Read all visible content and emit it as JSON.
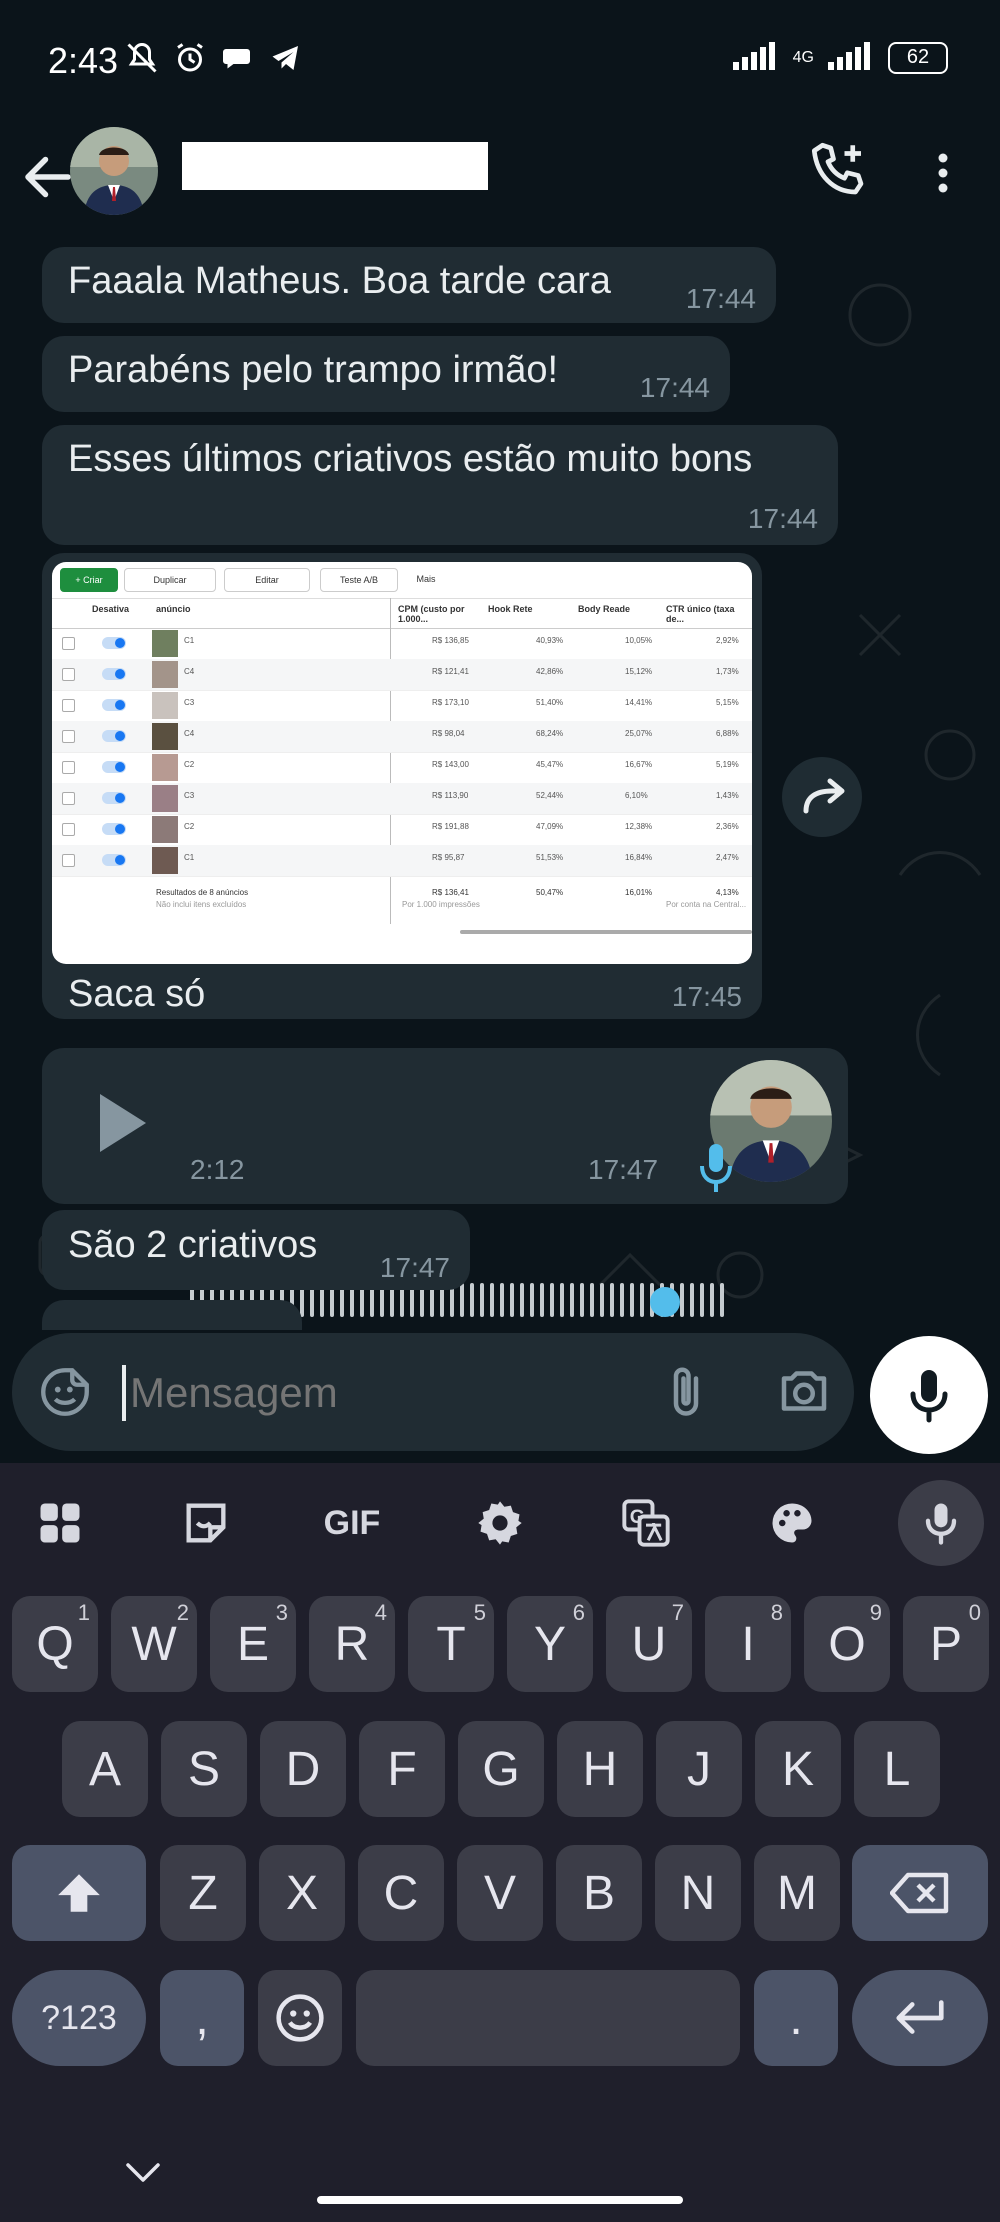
{
  "status_bar": {
    "time": "2:43",
    "network": "4G",
    "battery": "62"
  },
  "header": {
    "contact_name": ""
  },
  "messages": [
    {
      "text": "Faaala Matheus. Boa tarde cara",
      "time": "17:44"
    },
    {
      "text": "Parabéns pelo trampo irmão!",
      "time": "17:44"
    },
    {
      "text": "Esses últimos criativos estão muito bons",
      "time": "17:44"
    },
    {
      "text": "Saca só",
      "time": "17:45"
    },
    {
      "text": "São 2 criativos",
      "time": "17:47"
    }
  ],
  "voice_message": {
    "duration": "2:12",
    "time": "17:47"
  },
  "shared_table": {
    "toolbar": [
      "+ Criar",
      "Duplicar",
      "Editar",
      "Teste A/B",
      "Mais"
    ],
    "columns": [
      "Desativa",
      "anúncio",
      "CPM (custo por 1.000...",
      "Hook Rete",
      "Body Reade",
      "CTR único (taxa de..."
    ],
    "rows": [
      {
        "ad": "C1",
        "cpm": "R$ 136,85",
        "hook": "40,93%",
        "body": "10,05%",
        "ctr": "2,92%"
      },
      {
        "ad": "C4",
        "cpm": "R$ 121,41",
        "hook": "42,86%",
        "body": "15,12%",
        "ctr": "1,73%"
      },
      {
        "ad": "C3",
        "cpm": "R$ 173,10",
        "hook": "51,40%",
        "body": "14,41%",
        "ctr": "5,15%"
      },
      {
        "ad": "C4",
        "cpm": "R$ 98,04",
        "hook": "68,24%",
        "body": "25,07%",
        "ctr": "6,88%"
      },
      {
        "ad": "C2",
        "cpm": "R$ 143,00",
        "hook": "45,47%",
        "body": "16,67%",
        "ctr": "5,19%"
      },
      {
        "ad": "C3",
        "cpm": "R$ 113,90",
        "hook": "52,44%",
        "body": "6,10%",
        "ctr": "1,43%"
      },
      {
        "ad": "C2",
        "cpm": "R$ 191,88",
        "hook": "47,09%",
        "body": "12,38%",
        "ctr": "2,36%"
      },
      {
        "ad": "C1",
        "cpm": "R$ 95,87",
        "hook": "51,53%",
        "body": "16,84%",
        "ctr": "2,47%"
      }
    ],
    "footer": {
      "label": "Resultados de 8 anúncios",
      "sublabel": "Não inclui itens excluídos",
      "cpm": "R$ 136,41",
      "cpm_note": "Por 1.000 impressões",
      "hook": "50,47%",
      "body": "16,01%",
      "ctr": "4,13%",
      "ctr_note": "Por conta na Central..."
    }
  },
  "composer": {
    "placeholder": "Mensagem"
  },
  "keyboard": {
    "toolbar": [
      "apps",
      "sticker",
      "GIF",
      "settings",
      "translate",
      "theme",
      "voice"
    ],
    "row1": [
      {
        "k": "Q",
        "n": "1"
      },
      {
        "k": "W",
        "n": "2"
      },
      {
        "k": "E",
        "n": "3"
      },
      {
        "k": "R",
        "n": "4"
      },
      {
        "k": "T",
        "n": "5"
      },
      {
        "k": "Y",
        "n": "6"
      },
      {
        "k": "U",
        "n": "7"
      },
      {
        "k": "I",
        "n": "8"
      },
      {
        "k": "O",
        "n": "9"
      },
      {
        "k": "P",
        "n": "0"
      }
    ],
    "row2": [
      "A",
      "S",
      "D",
      "F",
      "G",
      "H",
      "J",
      "K",
      "L"
    ],
    "row3": [
      "Z",
      "X",
      "C",
      "V",
      "B",
      "N",
      "M"
    ],
    "symbols": "?123",
    "comma": ",",
    "period": ".",
    "gif_label": "GIF"
  }
}
